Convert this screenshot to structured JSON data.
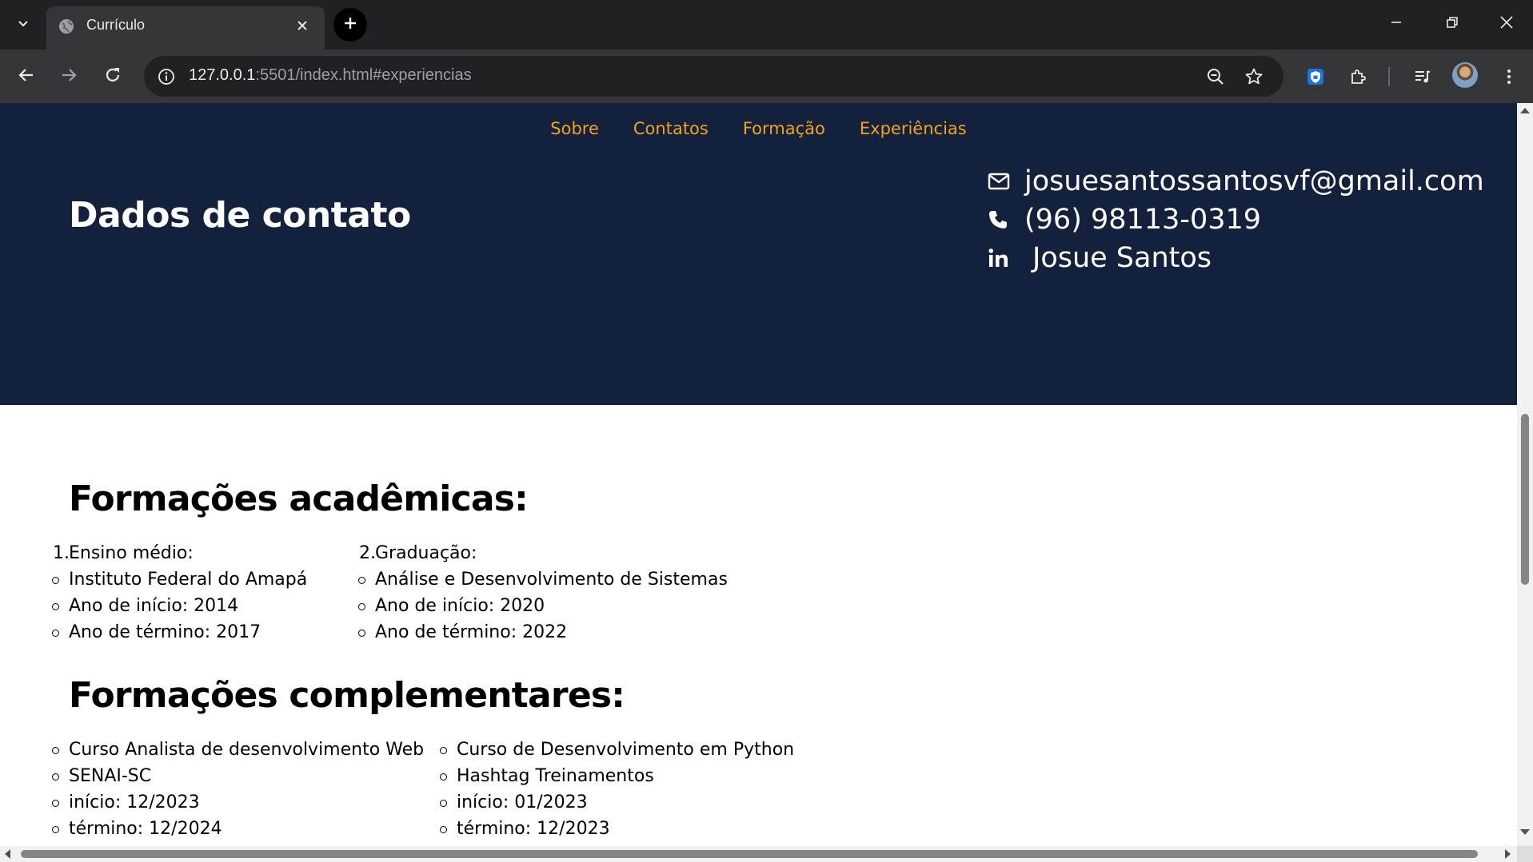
{
  "browser": {
    "tab_title": "Currículo",
    "url_host": "127.0.0.1",
    "url_rest": ":5501/index.html#experiencias"
  },
  "colors": {
    "hero_bg": "#14213d",
    "nav_link": "#f3a21b",
    "chrome_bg": "#202124"
  },
  "icons": {
    "tab_list": "chevron-down-icon",
    "favicon": "globe-icon",
    "tab_close": "close-icon",
    "new_tab": "plus-icon",
    "back": "arrow-left-icon",
    "forward": "arrow-right-icon",
    "reload": "reload-icon",
    "site_info": "info-icon",
    "zoom": "zoom-out-icon",
    "bookmark": "star-icon",
    "extension_pinned": "shield-extension-icon",
    "extensions": "puzzle-icon",
    "media": "media-queue-icon",
    "menu": "kebab-menu-icon",
    "email": "mail-icon",
    "phone": "phone-icon",
    "linkedin": "linkedin-icon"
  },
  "nav": {
    "items": [
      {
        "label": "Sobre"
      },
      {
        "label": "Contatos"
      },
      {
        "label": "Formação"
      },
      {
        "label": "Experiências"
      }
    ]
  },
  "contact": {
    "title": "Dados de contato",
    "email": "josuesantossantosvf@gmail.com",
    "phone": "(96) 98113-0319",
    "linkedin": "Josue Santos"
  },
  "academic": {
    "title": "Formações acadêmicas:",
    "items": [
      {
        "number": "1.",
        "heading": "Ensino médio:",
        "details": [
          "Instituto Federal do Amapá",
          "Ano de início: 2014",
          "Ano de término: 2017"
        ]
      },
      {
        "number": "2.",
        "heading": "Graduação:",
        "details": [
          "Análise e Desenvolvimento de Sistemas",
          "Ano de início: 2020",
          "Ano de término: 2022"
        ]
      }
    ]
  },
  "complementary": {
    "title": "Formações complementares:",
    "items": [
      {
        "details": [
          "Curso Analista de desenvolvimento Web",
          "SENAI-SC",
          "início: 12/2023",
          "término: 12/2024"
        ]
      },
      {
        "details": [
          "Curso de Desenvolvimento em Python",
          "Hashtag Treinamentos",
          "início: 01/2023",
          "término: 12/2023"
        ]
      }
    ]
  }
}
